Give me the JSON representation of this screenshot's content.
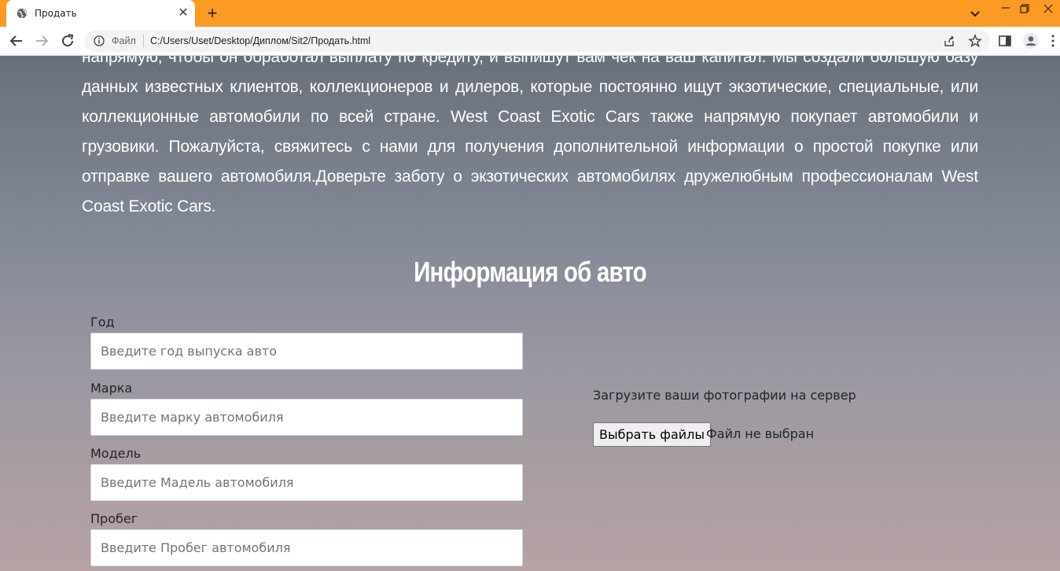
{
  "browser": {
    "tab_title": "Продать",
    "new_tab": "+",
    "close_tab": "✕",
    "file_label": "Файл",
    "url": "C:/Users/Uset/Desktop/Диплом/Sit2/Продать.html"
  },
  "page": {
    "intro_text": "напрямую, чтобы он обработал выплату по кредиту, и выпишут вам чек на ваш капитал. Мы создали большую базу данных известных клиентов, коллекционеров и дилеров, которые постоянно ищут экзотические, специальные, или коллекционные автомобили по всей стране. West Coast Exotic Cars также напрямую покупает автомобили и грузовики. Пожалуйста, свяжитесь с нами для получения дополнительной информации о простой покупке или отправке вашего автомобиля.Доверьте заботу о экзотических автомобилях дружелюбным профессионалам West Coast Exotic Cars.",
    "section_title": "Информация об авто",
    "form": {
      "year_label": "Год",
      "year_placeholder": "Введите год выпуска авто",
      "make_label": "Марка",
      "make_placeholder": "Введите марку автомобиля",
      "model_label": "Модель",
      "model_placeholder": "Введите Мадель автомобиля",
      "mileage_label": "Пробег",
      "mileage_placeholder": "Введите Пробег автомобиля"
    },
    "upload": {
      "label": "Загрузите ваши фотографии на сервер",
      "button": "Выбрать файлы",
      "status": "Файл не выбран"
    }
  },
  "colors": {
    "tabstrip": "#fd9a23",
    "gradient_top": "#69707b",
    "gradient_bottom": "#b7a2a5"
  }
}
